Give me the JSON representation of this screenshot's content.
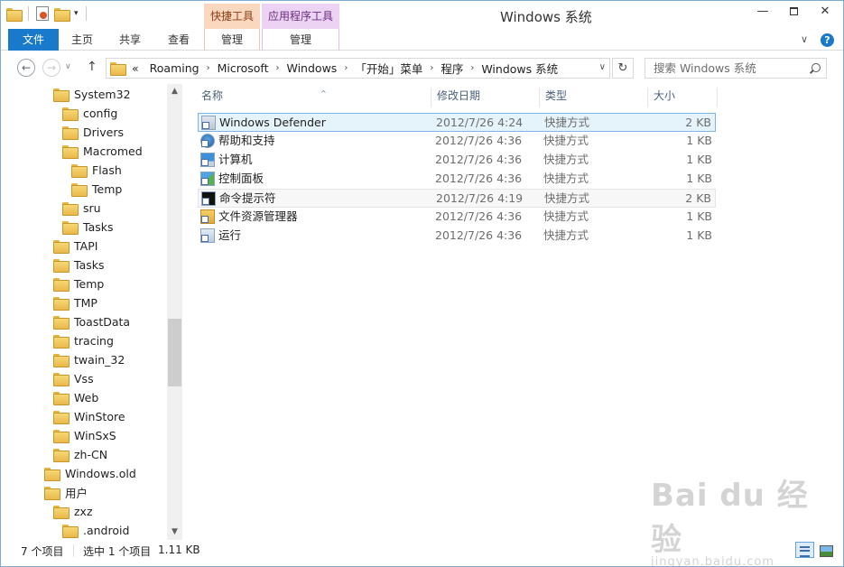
{
  "window": {
    "title": "Windows 系统",
    "minimize_glyph": "—",
    "close_glyph": "✕"
  },
  "ribbon": {
    "context_shortcut_tools": "快捷工具",
    "context_app_tools": "应用程序工具",
    "tabs": {
      "file": "文件",
      "home": "主页",
      "share": "共享",
      "view": "查看",
      "manage1": "管理",
      "manage2": "管理"
    },
    "expand_glyph": "∨",
    "help_glyph": "?"
  },
  "nav": {
    "back_glyph": "←",
    "forward_glyph": "→",
    "recent_glyph": "∨",
    "up_glyph": "↑",
    "refresh_glyph": "↻",
    "address": {
      "overflow": "«",
      "crumbs": [
        "Roaming",
        "Microsoft",
        "Windows",
        "「开始」菜单",
        "程序",
        "Windows 系统"
      ],
      "arrow": "›",
      "dropdown_glyph": "∨"
    },
    "search_placeholder": "搜索 Windows 系统"
  },
  "tree": [
    {
      "label": "System32",
      "level": 1
    },
    {
      "label": "config",
      "level": 2
    },
    {
      "label": "Drivers",
      "level": 2
    },
    {
      "label": "Macromed",
      "level": 2
    },
    {
      "label": "Flash",
      "level": 3
    },
    {
      "label": "Temp",
      "level": 3
    },
    {
      "label": "sru",
      "level": 2
    },
    {
      "label": "Tasks",
      "level": 2
    },
    {
      "label": "TAPI",
      "level": 1
    },
    {
      "label": "Tasks",
      "level": 1
    },
    {
      "label": "Temp",
      "level": 1
    },
    {
      "label": "TMP",
      "level": 1
    },
    {
      "label": "ToastData",
      "level": 1
    },
    {
      "label": "tracing",
      "level": 1
    },
    {
      "label": "twain_32",
      "level": 1
    },
    {
      "label": "Vss",
      "level": 1
    },
    {
      "label": "Web",
      "level": 1
    },
    {
      "label": "WinStore",
      "level": 1
    },
    {
      "label": "WinSxS",
      "level": 1
    },
    {
      "label": "zh-CN",
      "level": 1
    },
    {
      "label": "Windows.old",
      "level": 0
    },
    {
      "label": "用户",
      "level": 0
    },
    {
      "label": "zxz",
      "level": 1
    },
    {
      "label": ".android",
      "level": 2
    }
  ],
  "scroll": {
    "up_glyph": "▲",
    "down_glyph": "▼"
  },
  "columns": {
    "name": "名称",
    "modified": "修改日期",
    "type": "类型",
    "size": "大小",
    "sort_glyph": "^"
  },
  "files": [
    {
      "name": "Windows Defender",
      "date": "2012/7/26 4:24",
      "type": "快捷方式",
      "size": "2 KB",
      "icon": "defender-icon",
      "state": "selected"
    },
    {
      "name": "帮助和支持",
      "date": "2012/7/26 4:36",
      "type": "快捷方式",
      "size": "1 KB",
      "icon": "help-icon",
      "state": ""
    },
    {
      "name": "计算机",
      "date": "2012/7/26 4:36",
      "type": "快捷方式",
      "size": "1 KB",
      "icon": "computer-icon",
      "state": ""
    },
    {
      "name": "控制面板",
      "date": "2012/7/26 4:36",
      "type": "快捷方式",
      "size": "1 KB",
      "icon": "control-panel-icon",
      "state": ""
    },
    {
      "name": "命令提示符",
      "date": "2012/7/26 4:19",
      "type": "快捷方式",
      "size": "2 KB",
      "icon": "cmd-icon",
      "state": "hover"
    },
    {
      "name": "文件资源管理器",
      "date": "2012/7/26 4:36",
      "type": "快捷方式",
      "size": "1 KB",
      "icon": "explorer-icon",
      "state": ""
    },
    {
      "name": "运行",
      "date": "2012/7/26 4:36",
      "type": "快捷方式",
      "size": "1 KB",
      "icon": "run-icon",
      "state": ""
    }
  ],
  "status": {
    "item_count": "7 个项目",
    "selected": "选中 1 个项目",
    "selected_size": "1.11 KB"
  },
  "watermark": {
    "logo": "Bai du 经验",
    "url": "jingyan.baidu.com"
  }
}
